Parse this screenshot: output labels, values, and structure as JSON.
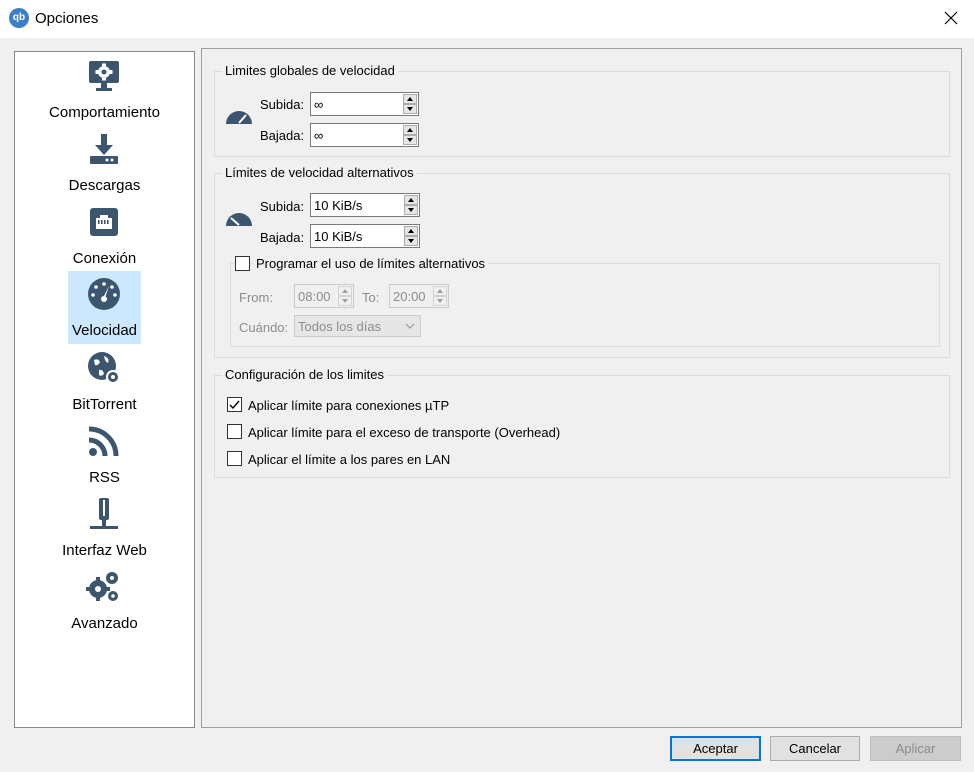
{
  "window": {
    "title": "Opciones",
    "app_logo_text": "qb"
  },
  "sidebar": {
    "items": [
      {
        "label": "Comportamiento",
        "icon": "monitor-gear-icon",
        "selected": false
      },
      {
        "label": "Descargas",
        "icon": "download-icon",
        "selected": false
      },
      {
        "label": "Conexión",
        "icon": "network-port-icon",
        "selected": false
      },
      {
        "label": "Velocidad",
        "icon": "speedometer-icon",
        "selected": true
      },
      {
        "label": "BitTorrent",
        "icon": "globe-gear-icon",
        "selected": false
      },
      {
        "label": "RSS",
        "icon": "rss-icon",
        "selected": false
      },
      {
        "label": "Interfaz Web",
        "icon": "web-ui-icon",
        "selected": false
      },
      {
        "label": "Avanzado",
        "icon": "gears-icon",
        "selected": false
      }
    ]
  },
  "global_limits": {
    "title": "Limites globales de velocidad",
    "upload_label": "Subida:",
    "upload_value": "∞",
    "download_label": "Bajada:",
    "download_value": "∞"
  },
  "alt_limits": {
    "title": "Límites de velocidad alternativos",
    "upload_label": "Subida:",
    "upload_value": "10 KiB/s",
    "download_label": "Bajada:",
    "download_value": "10 KiB/s",
    "schedule": {
      "label": "Programar el uso de límites alternativos",
      "checked": false,
      "from_label": "From:",
      "from_value": "08:00",
      "to_label": "To:",
      "to_value": "20:00",
      "when_label": "Cuándo:",
      "when_value": "Todos los días"
    }
  },
  "limits_config": {
    "title": "Configuración de los limites",
    "options": [
      {
        "label": "Aplicar límite para conexiones µTP",
        "checked": true
      },
      {
        "label": "Aplicar límite para el exceso de transporte (Overhead)",
        "checked": false
      },
      {
        "label": "Aplicar el límite a los pares en LAN",
        "checked": false
      }
    ]
  },
  "buttons": {
    "accept": "Aceptar",
    "cancel": "Cancelar",
    "apply": "Aplicar"
  },
  "colors": {
    "icon": "#3c5670",
    "selection": "#cce8ff",
    "accent": "#0078d7"
  }
}
